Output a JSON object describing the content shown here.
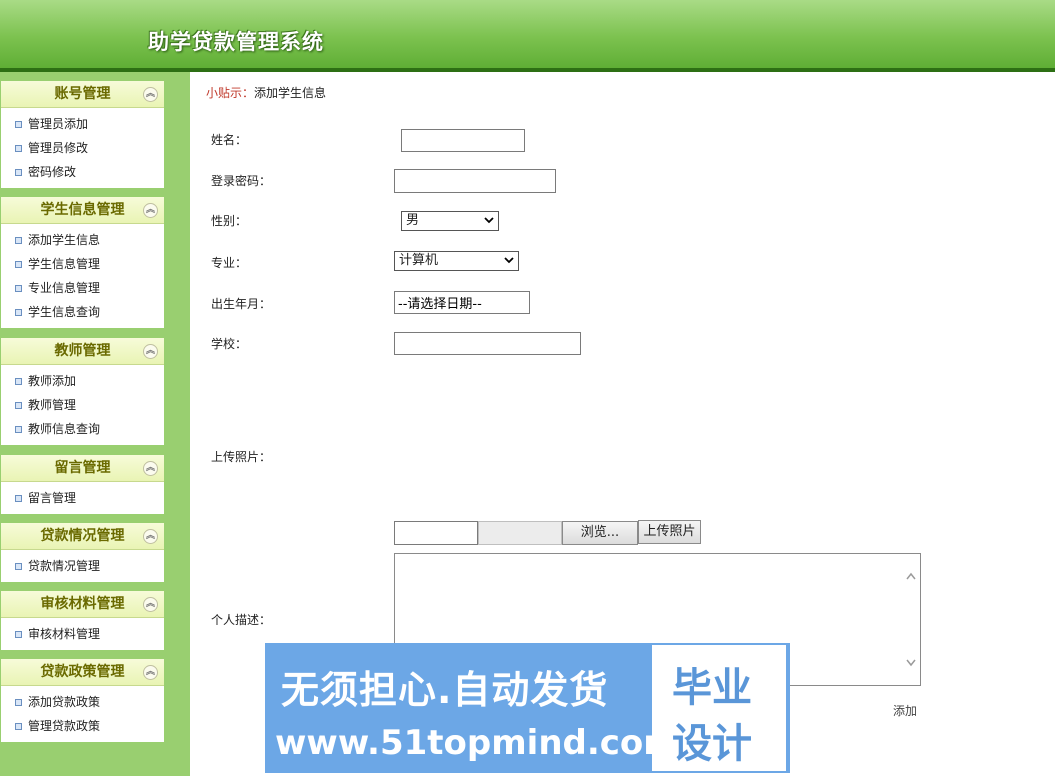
{
  "app": {
    "title": "助学贷款管理系统"
  },
  "sidebar": {
    "groups": [
      {
        "title": "账号管理",
        "items": [
          "管理员添加",
          "管理员修改",
          "密码修改"
        ]
      },
      {
        "title": "学生信息管理",
        "items": [
          "添加学生信息",
          "学生信息管理",
          "专业信息管理",
          "学生信息查询"
        ]
      },
      {
        "title": "教师管理",
        "items": [
          "教师添加",
          "教师管理",
          "教师信息查询"
        ]
      },
      {
        "title": "留言管理",
        "items": [
          "留言管理"
        ]
      },
      {
        "title": "贷款情况管理",
        "items": [
          "贷款情况管理"
        ]
      },
      {
        "title": "审核材料管理",
        "items": [
          "审核材料管理"
        ]
      },
      {
        "title": "贷款政策管理",
        "items": [
          "添加贷款政策",
          "管理贷款政策"
        ]
      }
    ]
  },
  "tip": {
    "label": "小贴示：",
    "text": "添加学生信息"
  },
  "form": {
    "name_label": "姓名：",
    "password_label": "登录密码：",
    "gender_label": "性别：",
    "gender_value": "男",
    "major_label": "专业：",
    "major_value": "计算机",
    "birth_label": "出生年月：",
    "birth_value": "--请选择日期--",
    "school_label": "学校：",
    "photo_label": "上传照片：",
    "browse_label": "浏览...",
    "upload_label": "上传照片",
    "desc_label": "个人描述：",
    "submit_label": "添加"
  },
  "watermark": {
    "line1": "无须担心.自动发货",
    "line2": "www.51topmind.com",
    "box_top": "毕业",
    "box_bottom": "设计"
  },
  "colors": {
    "header": "#7cc24f",
    "sidebar": "#99cf70",
    "watermark": "#6ca7e6",
    "tip_label": "#c0392b"
  }
}
